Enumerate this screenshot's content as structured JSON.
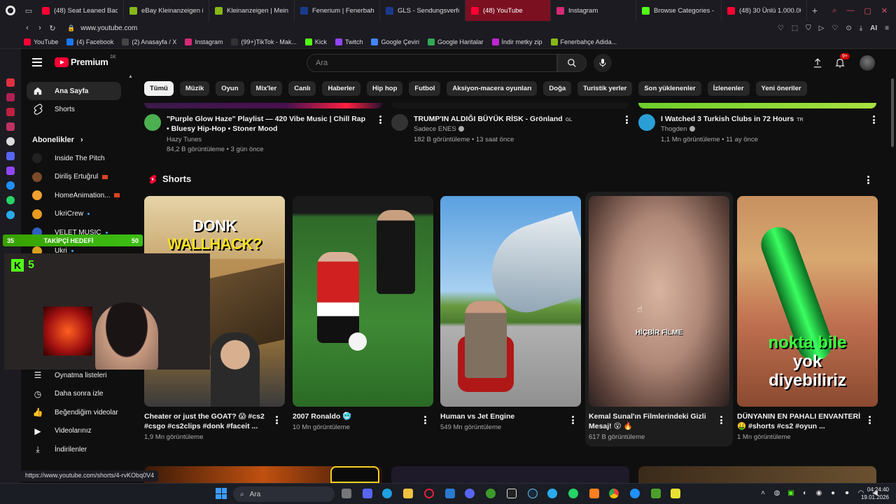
{
  "browser": {
    "tabs": [
      {
        "label": "(48) Seat Leaned Back P",
        "color": "#ff0033"
      },
      {
        "label": "eBay Kleinanzeigen ist je",
        "color": "#86b817"
      },
      {
        "label": "Kleinanzeigen | Meine N",
        "color": "#86b817"
      },
      {
        "label": "Fenerium | Fenerbahçe 2",
        "color": "#1a3b8c"
      },
      {
        "label": "GLS - Sendungsverfolgu",
        "color": "#1a3b8c"
      },
      {
        "label": "(48) YouTube",
        "color": "#ff0033",
        "active": true
      },
      {
        "label": "Instagram",
        "color": "#d62976"
      },
      {
        "label": "Browse Categories - Kic",
        "color": "#53fc18"
      },
      {
        "label": "(48) 30 Ünlü 1.000.000 D",
        "color": "#ff0033"
      }
    ],
    "url": "www.youtube.com",
    "bookmarks": [
      {
        "label": "YouTube",
        "color": "#ff0033"
      },
      {
        "label": "(4) Facebook",
        "color": "#1877f2"
      },
      {
        "label": "(2) Anasayfa / X",
        "color": "#444"
      },
      {
        "label": "Instagram",
        "color": "#d62976"
      },
      {
        "label": "(99+)TikTok - Mak...",
        "color": "#333"
      },
      {
        "label": "Kick",
        "color": "#53fc18"
      },
      {
        "label": "Twitch",
        "color": "#9146ff"
      },
      {
        "label": "Google Çeviri",
        "color": "#4285f4"
      },
      {
        "label": "Google Haritalar",
        "color": "#34a853"
      },
      {
        "label": "İndir metky zip",
        "color": "#c026d3"
      },
      {
        "label": "Fenerbahçe Adida...",
        "color": "#86b817"
      }
    ],
    "status_url": "https://www.youtube.com/shorts/4-rvKObq0V4",
    "addr_right_label": "AI"
  },
  "youtube": {
    "logo_text": "Premium",
    "logo_country": "DE",
    "search_placeholder": "Ara",
    "notifications_badge": "9+",
    "sidebar": {
      "home": "Ana Sayfa",
      "shorts": "Shorts",
      "subscriptions_title": "Abonelikler",
      "subscriptions": [
        {
          "name": "Inside The Pitch",
          "color": "#222"
        },
        {
          "name": "Diriliş Ertuğrul",
          "color": "#7a4a2a"
        },
        {
          "name": "HomeAnimation...",
          "color": "#f0a030"
        },
        {
          "name": "UkriCrew",
          "color": "#e89a20"
        },
        {
          "name": "VELET MUSIC",
          "color": "#3060c0"
        },
        {
          "name": "Ukri",
          "color": "#d8a020"
        }
      ],
      "lower": [
        {
          "label": "Oynatma listeleri",
          "icon": "playlist-icon"
        },
        {
          "label": "Daha sonra izle",
          "icon": "clock-icon"
        },
        {
          "label": "Beğendiğim videolar",
          "icon": "thumbs-up-icon"
        },
        {
          "label": "Videolarınız",
          "icon": "video-icon"
        },
        {
          "label": "İndirilenler",
          "icon": "download-icon"
        }
      ]
    },
    "chips": [
      "Tümü",
      "Müzik",
      "Oyun",
      "Mix'ler",
      "Canlı",
      "Haberler",
      "Hip hop",
      "Futbol",
      "Aksiyon-macera oyunları",
      "Doğa",
      "Turistik yerler",
      "Son yüklenenler",
      "İzlenenler",
      "Yeni öneriler"
    ],
    "videos": [
      {
        "title": "\"Purple Glow Haze\" Playlist — 420 Vibe Music | Chill Rap • Bluesy Hip-Hop • Stoner Mood",
        "channel": "Hazy Tunes",
        "meta": "84,2 B görüntüleme • 3 gün önce",
        "avatar_color": "#4caf50"
      },
      {
        "title": "TRUMP'IN ALDIĞI BÜYÜK RİSK - Grönland",
        "title_suffix": "GL",
        "channel": "Sadece ENES",
        "meta": "182 B görüntüleme • 13 saat önce",
        "avatar_color": "#333"
      },
      {
        "title": "I Watched 3 Turkish Clubs in 72 Hours",
        "title_suffix": "TR",
        "channel": "Thogden",
        "meta": "1,1 Mn görüntüleme • 11 ay önce",
        "avatar_color": "#2a9fd6"
      }
    ],
    "shorts_title": "Shorts",
    "shorts": [
      {
        "title": "Cheater or just the GOAT? 😱 #cs2 #csgo #cs2clips #donk #faceit ...",
        "views": "1,9 Mn görüntüleme",
        "overlay_a": "DONK ",
        "overlay_b": "WALLHACK?"
      },
      {
        "title": "2007 Ronaldo 🥶",
        "views": "10 Mn görüntüleme",
        "overlay_a": "",
        "overlay_b": ""
      },
      {
        "title": "Human vs Jet Engine",
        "views": "549 Mn görüntüleme",
        "overlay_a": "",
        "overlay_b": ""
      },
      {
        "title": "Kemal Sunal'ın Filmlerindeki Gizli Mesaj! 😮 🔥",
        "views": "617 B görüntüleme",
        "overlay_a": "HİÇBİR FİLME",
        "overlay_b": ""
      },
      {
        "title": "DÜNYANIN EN PAHALI ENVANTERİ 🤑 #shorts #cs2 #oyun ...",
        "views": "1 Mn görüntüleme",
        "overlay_a": "nokta bile",
        "overlay_b": "yok",
        "overlay_c": "diyebiliriz"
      }
    ]
  },
  "stream_overlay": {
    "left_num": "35",
    "label": "TAKİPÇİ HEDEFİ",
    "right_num": "50",
    "kick_count": "5"
  },
  "taskbar": {
    "search_label": "Ara",
    "time": "04:24:40",
    "date": "19.01.2026"
  }
}
